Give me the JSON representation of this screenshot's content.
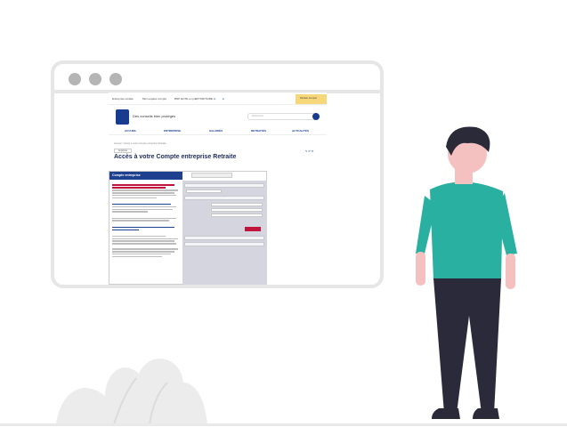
{
  "site": {
    "topnav": [
      "Entreprise retraite",
      "Mon espace compte",
      "BNP ELITE en pro",
      "AUTORITAIRE",
      "Retraite Compte"
    ],
    "tagline": "Des conseils bien protégés",
    "search_placeholder": "Rechercher",
    "menu": [
      "ACCUEIL",
      "ENTREPRISE",
      "SALARIÉS",
      "RETRAITÉS",
      "ACTUALITÉS"
    ],
    "breadcrumb": "Accueil > Accès à votre Compte entreprise Retraite",
    "page_title": "Accès à votre Compte entreprise Retraite",
    "panel_title": "Compte entreprise",
    "print_label": "Imprimer"
  },
  "colors": {
    "brand": "#163b8f",
    "shirt": "#2ab0a0",
    "pants": "#2b2a3b",
    "hair": "#2a2a38",
    "skin": "#f5c1c0"
  }
}
